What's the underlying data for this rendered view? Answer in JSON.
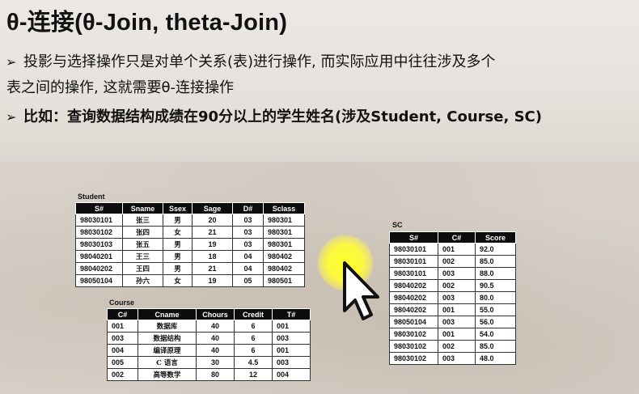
{
  "slide": {
    "title": "θ-连接(θ-Join, theta-Join)",
    "bullet1_line1": "投影与选择操作只是对单个关系(表)进行操作, 而实际应用中往往涉及多个",
    "bullet1_line2": "表之间的操作, 这就需要θ-连接操作",
    "bullet2": "比如：查询数据结构成绩在90分以上的学生姓名(涉及Student, Course, SC)",
    "bullet_marker": "➢"
  },
  "student": {
    "caption": "Student",
    "headers": [
      "S#",
      "Sname",
      "Ssex",
      "Sage",
      "D#",
      "Sclass"
    ],
    "rows": [
      [
        "98030101",
        "张三",
        "男",
        "20",
        "03",
        "980301"
      ],
      [
        "98030102",
        "张四",
        "女",
        "21",
        "03",
        "980301"
      ],
      [
        "98030103",
        "张五",
        "男",
        "19",
        "03",
        "980301"
      ],
      [
        "98040201",
        "王三",
        "男",
        "18",
        "04",
        "980402"
      ],
      [
        "98040202",
        "王四",
        "男",
        "21",
        "04",
        "980402"
      ],
      [
        "98050104",
        "孙六",
        "女",
        "19",
        "05",
        "980501"
      ]
    ]
  },
  "course": {
    "caption": "Course",
    "headers": [
      "C#",
      "Cname",
      "Chours",
      "Credit",
      "T#"
    ],
    "rows": [
      [
        "001",
        "数据库",
        "40",
        "6",
        "001"
      ],
      [
        "003",
        "数据结构",
        "40",
        "6",
        "003"
      ],
      [
        "004",
        "编译原理",
        "40",
        "6",
        "001"
      ],
      [
        "005",
        "C 语言",
        "30",
        "4.5",
        "003"
      ],
      [
        "002",
        "高等数学",
        "80",
        "12",
        "004"
      ]
    ]
  },
  "sc": {
    "caption": "SC",
    "headers": [
      "S#",
      "C#",
      "Score"
    ],
    "rows": [
      [
        "98030101",
        "001",
        "92.0"
      ],
      [
        "98030101",
        "002",
        "85.0"
      ],
      [
        "98030101",
        "003",
        "88.0"
      ],
      [
        "98040202",
        "002",
        "90.5"
      ],
      [
        "98040202",
        "003",
        "80.0"
      ],
      [
        "98040202",
        "001",
        "55.0"
      ],
      [
        "98050104",
        "003",
        "56.0"
      ],
      [
        "98030102",
        "001",
        "54.0"
      ],
      [
        "98030102",
        "002",
        "85.0"
      ],
      [
        "98030102",
        "003",
        "48.0"
      ]
    ]
  },
  "pointer": {
    "icon": "mouse-pointer-icon",
    "highlight_color": "#ffff28"
  }
}
